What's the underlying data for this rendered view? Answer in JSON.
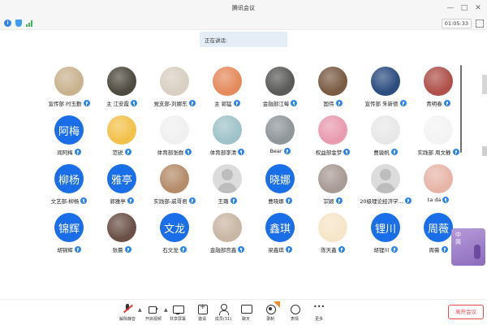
{
  "window": {
    "title": "腾讯会议"
  },
  "status": {
    "timer": "01:05:33"
  },
  "speaking": {
    "label": "正在讲话:"
  },
  "colors": {
    "accent": "#1a6ee8",
    "mic": "#2d86f0",
    "leave": "#e84a4a"
  },
  "participants": [
    {
      "name": "宣传部 时玉勤",
      "avatar": "photo",
      "bg": "#c9b28e"
    },
    {
      "name": "主   江安霞",
      "avatar": "photo",
      "bg": "#4e4a3f"
    },
    {
      "name": "党支部-刘娜东",
      "avatar": "photo",
      "bg": "#d9cfc2"
    },
    {
      "name": "主  郭猛",
      "avatar": "photo",
      "bg": "#e58a5c"
    },
    {
      "name": "金融部江莓",
      "avatar": "photo",
      "bg": "#5a5a58"
    },
    {
      "name": "国伟",
      "avatar": "photo",
      "bg": "#7a5c44"
    },
    {
      "name": "宣传部  朱新德",
      "avatar": "photo",
      "bg": "#2c4d80"
    },
    {
      "name": "青明春",
      "avatar": "photo",
      "bg": "#b0504a"
    },
    {
      "name": "阎阿梅",
      "avatar": "text",
      "text": "阿梅"
    },
    {
      "name": "范锐",
      "avatar": "photo",
      "bg": "#f2c14a"
    },
    {
      "name": "体育部张群",
      "avatar": "photo",
      "bg": "#f0f0f0"
    },
    {
      "name": "体育部李清",
      "avatar": "photo",
      "bg": "#9fc3c9"
    },
    {
      "name": "Bear",
      "avatar": "photo",
      "bg": "#8f969a"
    },
    {
      "name": "权益部金梦",
      "avatar": "photo",
      "bg": "#e99bb0"
    },
    {
      "name": "曹骏帆",
      "avatar": "photo",
      "bg": "#e8e8e8"
    },
    {
      "name": "实践部 周文静",
      "avatar": "photo",
      "bg": "#f4f4f4"
    },
    {
      "name": "文艺部-柳杨",
      "avatar": "text",
      "text": "柳杨"
    },
    {
      "name": "郭雅亭",
      "avatar": "text",
      "text": "雅亭"
    },
    {
      "name": "实践部-戚哥君",
      "avatar": "photo",
      "bg": "#b58c6a"
    },
    {
      "name": "王璐",
      "avatar": "gray"
    },
    {
      "name": "曹晓娜",
      "avatar": "text",
      "text": "晓娜"
    },
    {
      "name": "宗颖",
      "avatar": "photo",
      "bg": "#a89a95"
    },
    {
      "name": "20级理论经济学...",
      "avatar": "gray"
    },
    {
      "name": "ta da",
      "avatar": "photo",
      "bg": "#e7b5a8"
    },
    {
      "name": "胡锦辉",
      "avatar": "text",
      "text": "锦辉"
    },
    {
      "name": "张晨",
      "avatar": "photo",
      "bg": "#6a5046"
    },
    {
      "name": "石文龙",
      "avatar": "text",
      "text": "文龙"
    },
    {
      "name": "金融部宫鑫",
      "avatar": "photo",
      "bg": "#c9b6a4"
    },
    {
      "name": "梁鑫琪",
      "avatar": "text",
      "text": "鑫琪"
    },
    {
      "name": "陈天鑫",
      "avatar": "photo",
      "bg": "#f6e5c8"
    },
    {
      "name": "胡锂川",
      "avatar": "text",
      "text": "锂川"
    },
    {
      "name": "周薇",
      "avatar": "text",
      "text": "周薇"
    }
  ],
  "widget": {
    "line1": "中",
    "line2": "简"
  },
  "toolbar": {
    "mute": "解除静音",
    "video": "开启视频",
    "share": "共享屏幕",
    "invite": "邀请",
    "members": "成员(31)",
    "chat": "聊天",
    "record": "录制",
    "reactions": "表情",
    "more": "更多",
    "leave": "离开会议"
  }
}
